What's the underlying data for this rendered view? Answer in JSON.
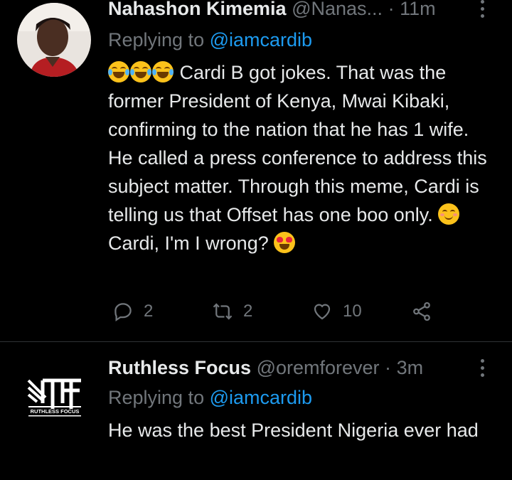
{
  "tweets": [
    {
      "name": "Nahashon Kimemia",
      "handle": "@Nanas...",
      "sep": "·",
      "time": "11m",
      "replying_label": "Replying to",
      "replying_to": "@iamcardib",
      "text_part1": "Cardi B got jokes. That was the former President of Kenya, Mwai Kibaki, confirming to the nation that he has 1 wife. He called a press conference to address this subject matter. Through this meme, Cardi is telling us that Offset has one boo only.",
      "text_part2": "Cardi, I'm I wrong?",
      "emojis_lead": [
        "face-with-tears-of-joy",
        "face-with-tears-of-joy",
        "face-with-tears-of-joy"
      ],
      "emoji_mid": "smiling-face-with-smiling-eyes",
      "emoji_end": "smiling-face-with-heart-eyes",
      "replies": "2",
      "retweets": "2",
      "likes": "10"
    },
    {
      "name": "Ruthless Focus",
      "handle": "@oremforever",
      "sep": "·",
      "time": "3m",
      "replying_label": "Replying to",
      "replying_to": "@iamcardib",
      "text": "He was the best President Nigeria ever had",
      "avatar_brand": "RUTHLESS FOCUS"
    }
  ],
  "colors": {
    "background": "#000000",
    "text": "#e7e9ea",
    "muted": "#71767b",
    "link": "#1d9bf0",
    "divider": "#2f3336"
  }
}
